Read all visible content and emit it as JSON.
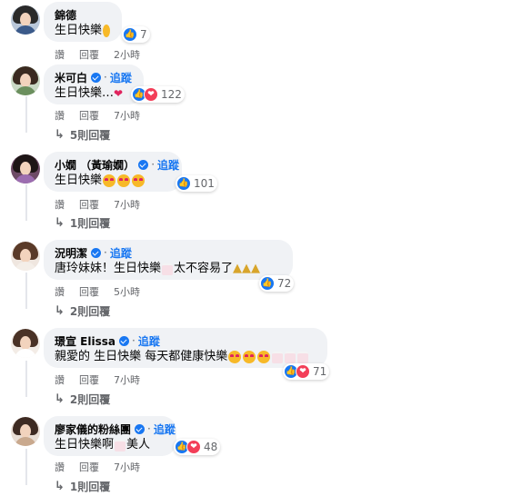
{
  "comments": [
    {
      "name": "錦德",
      "verified": false,
      "follow": "",
      "text": "生日快樂",
      "emoji": "smiley",
      "reactions": [
        "like"
      ],
      "count": "7",
      "actions": [
        "讚",
        "回覆"
      ],
      "time": "2小時",
      "replies": ""
    },
    {
      "name": "米可白",
      "verified": true,
      "follow": "追蹤",
      "text": "生日快樂…",
      "emoji": "heart",
      "reactions": [
        "like",
        "love"
      ],
      "count": "122",
      "actions": [
        "讚",
        "回覆"
      ],
      "time": "7小時",
      "replies": "5則回覆"
    },
    {
      "name": "小嫺 （黃瑜嫺）",
      "verified": true,
      "follow": "追蹤",
      "text": "生日快樂",
      "emoji": "love-x3",
      "reactions": [
        "like"
      ],
      "count": "101",
      "actions": [
        "讚",
        "回覆"
      ],
      "time": "7小時",
      "replies": "1則回覆"
    },
    {
      "name": "況明潔",
      "verified": true,
      "follow": "追蹤",
      "text": "唐玲妹妹！生日快樂",
      "text2": "太不容易了",
      "emoji": "cake-party",
      "reactions": [
        "like"
      ],
      "count": "72",
      "actions": [
        "讚",
        "回覆"
      ],
      "time": "5小時",
      "replies": "2則回覆"
    },
    {
      "name": "璟宣 Elissa",
      "verified": true,
      "follow": "追蹤",
      "text": "親愛的 生日快樂 每天都健康快樂",
      "emoji": "love-cakes",
      "reactions": [
        "like",
        "love"
      ],
      "count": "71",
      "actions": [
        "讚",
        "回覆"
      ],
      "time": "7小時",
      "replies": "2則回覆"
    },
    {
      "name": "廖家儀的粉絲團",
      "verified": true,
      "follow": "追蹤",
      "text": "生日快樂啊",
      "text2": "美人",
      "emoji": "cake",
      "reactions": [
        "like",
        "love"
      ],
      "count": "48",
      "actions": [
        "讚",
        "回覆"
      ],
      "time": "7小時",
      "replies": "1則回覆"
    }
  ],
  "colors": {
    "accent": "#1877f2",
    "bubble": "#f0f2f5",
    "muted": "#65676b",
    "love": "#f33e58"
  }
}
